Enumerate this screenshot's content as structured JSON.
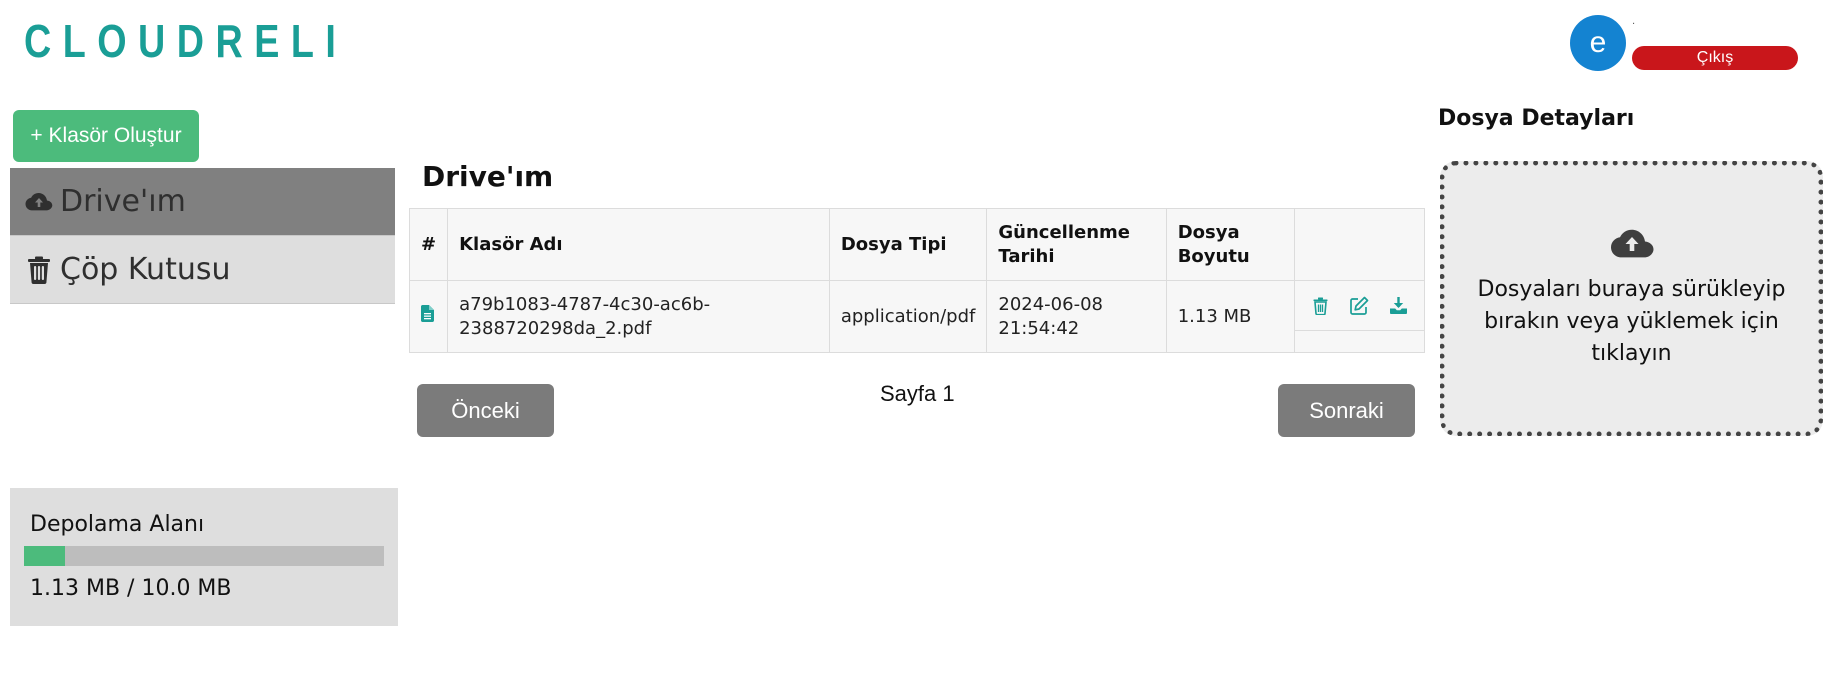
{
  "header": {
    "logo_text": "CLOUDRELI",
    "avatar_initial": "e",
    "username_text": "·",
    "logout_label": "Çıkış"
  },
  "sidebar": {
    "create_folder_label": "+ Klasör Oluştur",
    "items": [
      {
        "label": "Drive'ım",
        "icon": "cloud-upload-icon",
        "active": true
      },
      {
        "label": "Çöp Kutusu",
        "icon": "trash-icon",
        "active": false
      }
    ],
    "storage": {
      "title": "Depolama Alanı",
      "usage_text": "1.13 MB / 10.0 MB",
      "used_fraction": 0.113,
      "bar_color": "#4cbb7c"
    }
  },
  "main": {
    "title": "Drive'ım",
    "table": {
      "headers": [
        "#",
        "Klasör Adı",
        "Dosya Tipi",
        "Güncellenme Tarihi",
        "Dosya Boyutu",
        ""
      ],
      "rows": [
        {
          "icon": "file-icon",
          "name": "a79b1083-4787-4c30-ac6b-2388720298da_2.pdf",
          "type": "application/pdf",
          "updated": "2024-06-08 21:54:42",
          "size": "1.13 MB",
          "actions": [
            "trash-icon",
            "edit-icon",
            "download-icon"
          ]
        }
      ]
    },
    "pagination": {
      "prev_label": "Önceki",
      "page_label": "Sayfa 1",
      "next_label": "Sonraki"
    }
  },
  "details": {
    "title": "Dosya Detayları",
    "dropzone_text": "Dosyaları buraya sürükleyip bırakın veya yüklemek için tıklayın",
    "dropzone_icon": "cloud-upload-icon"
  },
  "colors": {
    "accent": "#1a9e96",
    "green": "#4cbb7c",
    "danger": "#c9161b",
    "avatar": "#1483d1"
  }
}
